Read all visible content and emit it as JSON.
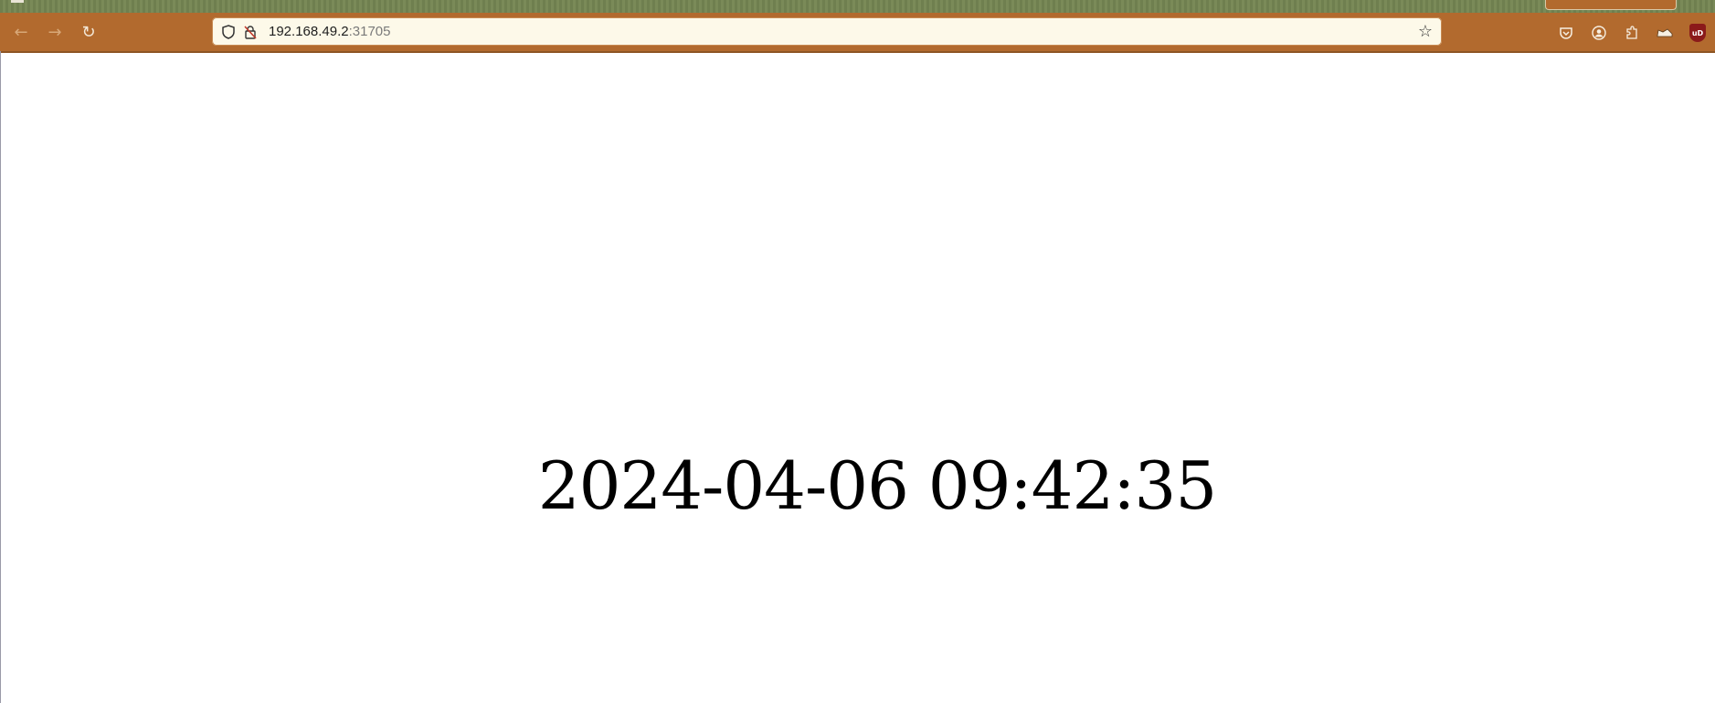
{
  "browser": {
    "url": {
      "host": "192.168.49.2",
      "port": ":31705"
    },
    "nav": {
      "back_icon": "arrow-left-icon",
      "forward_icon": "arrow-right-icon",
      "reload_icon": "reload-icon"
    },
    "toolbar_icons": [
      "pocket-icon",
      "account-icon",
      "extensions-icon",
      "sneaker-extension-icon",
      "ublock-origin-icon"
    ],
    "ublock_label": "uD"
  },
  "page": {
    "datetime": "2024-04-06 09:42:35"
  }
}
